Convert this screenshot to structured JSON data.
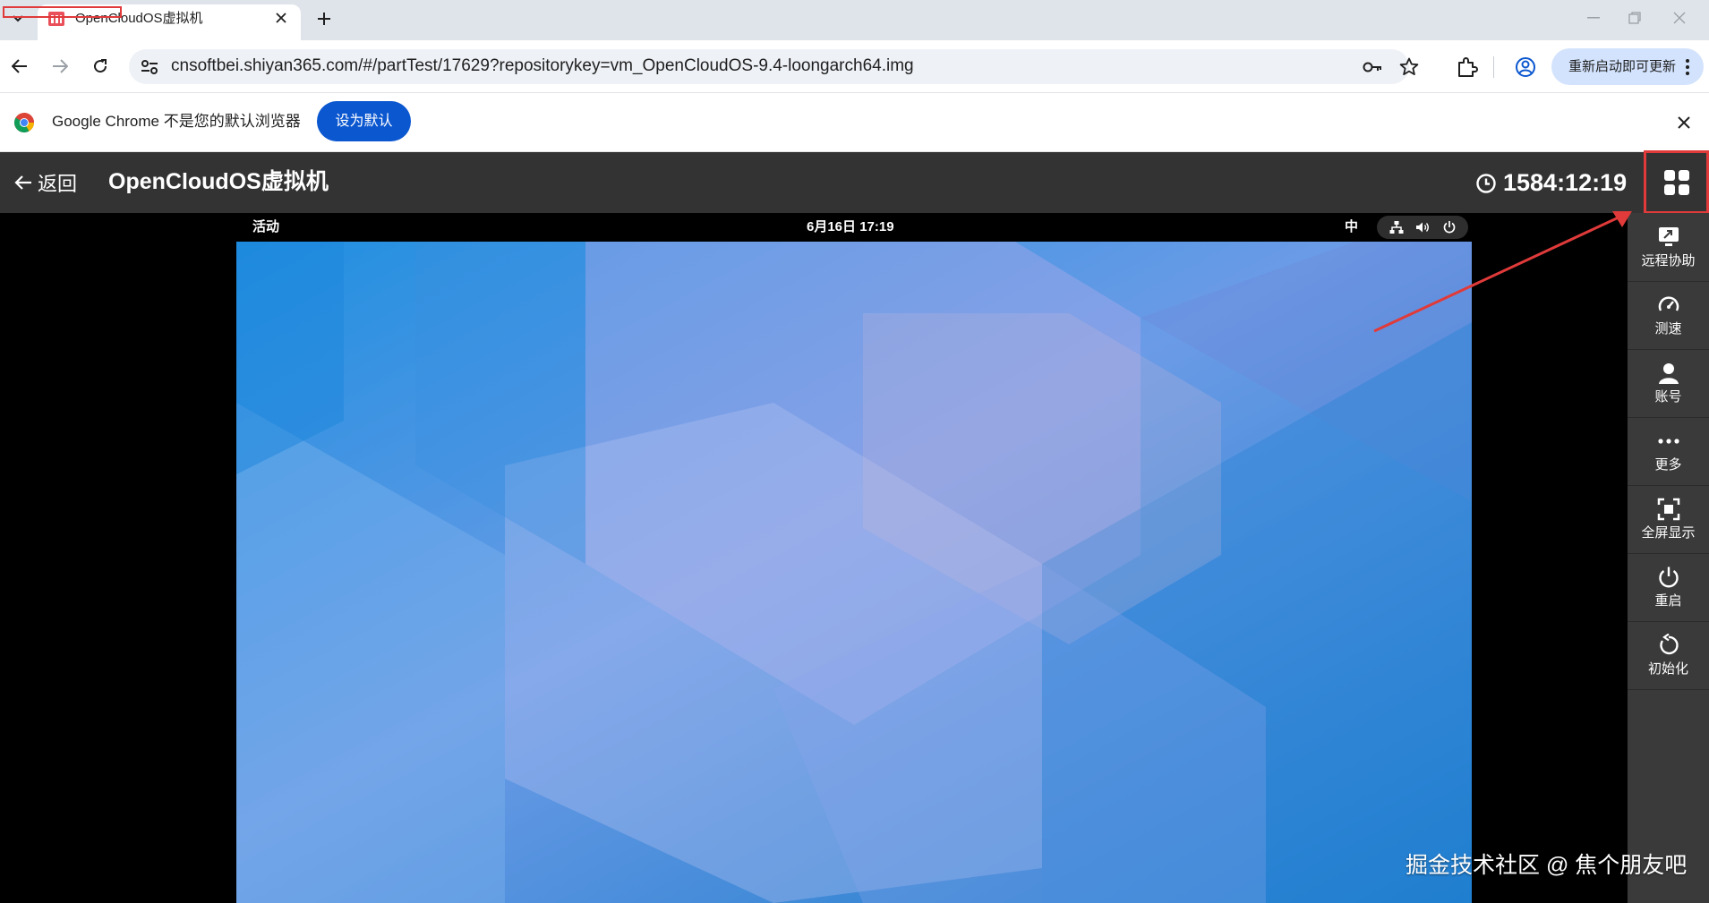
{
  "browser": {
    "tab_title": "OpenCloudOS虚拟机",
    "url": "cnsoftbei.shiyan365.com/#/partTest/17629?repositorykey=vm_OpenCloudOS-9.4-loongarch64.img",
    "update_label": "重新启动即可更新",
    "infobar_text": "Google Chrome 不是您的默认浏览器",
    "set_default_label": "设为默认"
  },
  "app": {
    "back_label": "返回",
    "title": "OpenCloudOS虚拟机",
    "timer": "1584:12:19"
  },
  "vm": {
    "activities": "活动",
    "clock": "6月16日  17:19",
    "input_method": "中"
  },
  "sidebar": {
    "items": [
      {
        "label": "远程协助",
        "icon": "remote-assist-icon"
      },
      {
        "label": "测速",
        "icon": "speedometer-icon"
      },
      {
        "label": "账号",
        "icon": "user-icon"
      },
      {
        "label": "更多",
        "icon": "more-dots-icon"
      },
      {
        "label": "全屏显示",
        "icon": "fullscreen-icon"
      },
      {
        "label": "重启",
        "icon": "power-icon"
      },
      {
        "label": "初始化",
        "icon": "reset-icon"
      }
    ]
  },
  "watermark": "掘金技术社区 @ 焦个朋友吧",
  "colors": {
    "header_bg": "#333333",
    "sidebar_bg": "#3a3a3a",
    "accent_red": "#e03a3a",
    "chrome_blue": "#0b57d0"
  }
}
